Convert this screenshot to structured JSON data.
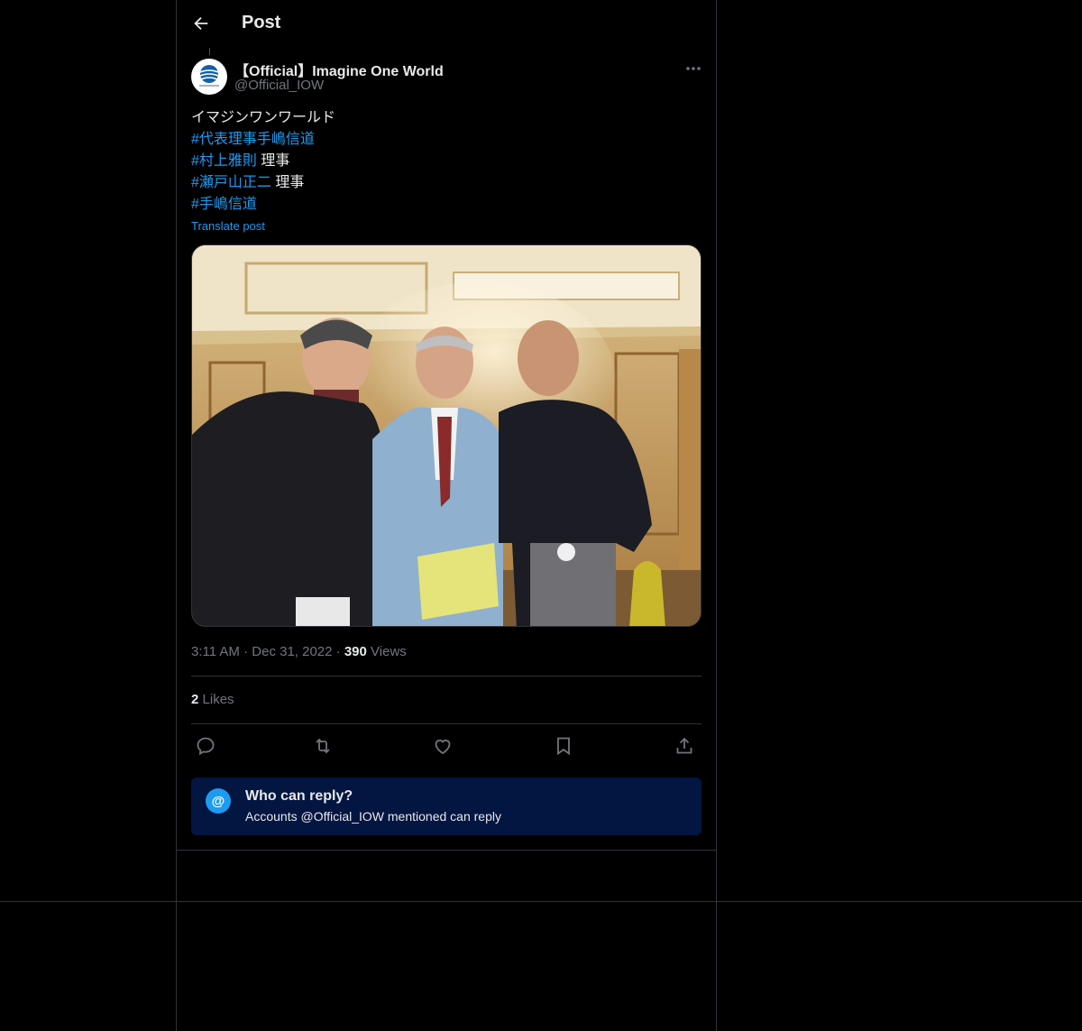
{
  "header": {
    "title": "Post"
  },
  "author": {
    "name": "【Official】Imagine One World",
    "handle": "@Official_IOW",
    "avatar_text": "Imagine One World"
  },
  "post": {
    "lines": [
      {
        "text": "イマジンワンワールド",
        "tag": "",
        "suffix": ""
      },
      {
        "text": "",
        "tag": "#代表理事手嶋信道",
        "suffix": ""
      },
      {
        "text": "",
        "tag": "#村上雅則",
        "suffix": " 理事"
      },
      {
        "text": "",
        "tag": "#瀬戸山正二",
        "suffix": " 理事"
      },
      {
        "text": "",
        "tag": "#手嶋信道",
        "suffix": ""
      }
    ],
    "translate_label": "Translate post"
  },
  "meta": {
    "time": "3:11 AM",
    "date": "Dec 31, 2022",
    "views_count": "390",
    "views_label": "Views"
  },
  "likes": {
    "count": "2",
    "label": "Likes"
  },
  "actions": [
    "reply-icon",
    "retweet-icon",
    "like-icon",
    "bookmark-icon",
    "share-icon"
  ],
  "who_can_reply": {
    "title": "Who can reply?",
    "subtitle": "Accounts @Official_IOW mentioned can reply"
  },
  "colors": {
    "accent": "#1d9bf0",
    "background": "#000000",
    "reply_box": "#031541",
    "muted": "#71767b"
  }
}
